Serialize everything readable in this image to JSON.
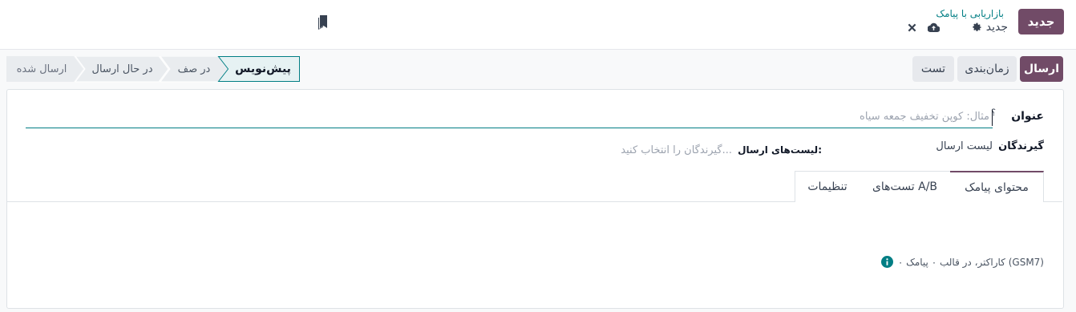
{
  "header": {
    "new_button": "جدید",
    "app_breadcrumb": "بازاریابی با پیامک",
    "record_name": "جدید",
    "icons": [
      "gear-icon",
      "cloud-upload-icon",
      "close-icon",
      "bookmark-icon"
    ]
  },
  "actions": {
    "send": "ارسال",
    "schedule": "زمان‌بندی",
    "test": "تست"
  },
  "stages": [
    "پیش‌نویس",
    "در صف",
    "در حال ارسال",
    "ارسال شده"
  ],
  "form": {
    "title_label": "عنوان",
    "title_help": "؟",
    "title_placeholder": "مثال: کوپن تخفیف جمعه سیاه",
    "recipients_label": "گیرندگان",
    "recipients_value": "لیست ارسال",
    "mailing_lists_label": "لیست‌های ارسال:",
    "mailing_lists_placeholder": "گیرندگان را انتخاب کنید..."
  },
  "tabs": {
    "content": "محتوای پیامک",
    "ab_tests": "تست‌های A/B",
    "settings": "تنظیمات"
  },
  "footer": {
    "sms_info": "۰ کاراکتر، در قالب ۰ پیامک (GSM7)"
  },
  "colors": {
    "brand": "#714b67",
    "link": "#017e84",
    "active_stage_border": "#017e84"
  }
}
